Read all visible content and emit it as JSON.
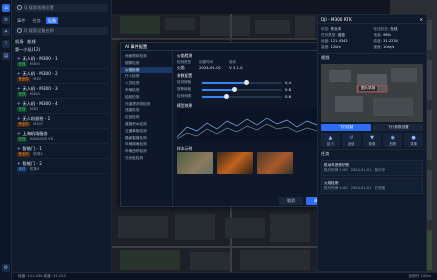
{
  "search": {
    "placeholder": "Q 搜索地理位置"
  },
  "left": {
    "tabs": [
      "事件",
      "任务",
      "设备"
    ],
    "filter_placeholder": "Q 搜索设备名称",
    "group_labels": [
      "机场",
      "航线"
    ],
    "group_count": "第一小队(12)",
    "devices": [
      {
        "name": "无人机 - M300 - 1",
        "id": "M300",
        "status": "在线",
        "sub": "M300"
      },
      {
        "name": "无人机 - M300 - 2",
        "id": "M30",
        "status": "作业中",
        "sub": "M30"
      },
      {
        "name": "无人机 - M300 - 3",
        "id": "M300",
        "status": "在线",
        "sub": "M300"
      },
      {
        "name": "无人机 - M300 - 4",
        "id": "M3D",
        "status": "在线",
        "sub": "M3D"
      },
      {
        "name": "无人机巡检 - 1",
        "id": "M30T",
        "status": "作业中",
        "sub": "M30T"
      },
      {
        "name": "上海机场服务",
        "id": "HAVASOR V6",
        "status": "在线",
        "sub": "V6"
      },
      {
        "name": "智能门 - 1",
        "id": "机场2",
        "status": "作业中",
        "sub": "机场"
      },
      {
        "name": "智能门 - 2",
        "id": "机场3",
        "status": "离线",
        "sub": "机场"
      }
    ]
  },
  "modal": {
    "title": "AI 事件配置",
    "nav": [
      "地面物体检测",
      "烟雾检测",
      "火焰检测",
      "行人检测",
      "人员检测",
      "车辆检测",
      "船舶检测",
      "河道漂浮物检测",
      "违建检测",
      "垃圾检测",
      "道路积水检测",
      "交通事故检测",
      "路面裂缝检测",
      "车辆拥堵检测",
      "车辆违停检测",
      "光伏板检测"
    ],
    "section": "火焰检测",
    "fields": [
      {
        "label": "检测类型",
        "value": "火焰"
      },
      {
        "label": "版本",
        "value": "V 3.1.0"
      },
      {
        "label": "创建时间",
        "value": "2024-01-01"
      }
    ],
    "param_title": "参数配置",
    "sliders": [
      {
        "label": "检测阈值",
        "value": "0.4",
        "level": 0.55
      },
      {
        "label": "报警阈值",
        "value": "0.8",
        "level": 0.4
      },
      {
        "label": "检测间隔",
        "value": "0.6",
        "level": 0.3
      }
    ],
    "chart_title": "模型效果",
    "sample_title": "样本示例",
    "cancel": "取消",
    "confirm": "确定"
  },
  "right": {
    "title": "DJI - M300 RTK",
    "close": "✕",
    "kv": [
      {
        "k": "状态:",
        "v": "作业中"
      },
      {
        "k": "在线状态:",
        "v": "在线"
      },
      {
        "k": "任务类型:",
        "v": "巡检"
      },
      {
        "k": "电量:",
        "v": "96%"
      },
      {
        "k": "经度:",
        "v": "121.4342"
      },
      {
        "k": "纬度:",
        "v": "31.2234"
      },
      {
        "k": "高度:",
        "v": "120m"
      },
      {
        "k": "速度:",
        "v": "10m/s"
      }
    ],
    "video_title": "视频",
    "video_label": "图片机场",
    "btn_left": "飞行控制",
    "btn_right": "飞行参数设置",
    "controls": [
      "起飞",
      "返航",
      "降落",
      "拍照",
      "录像"
    ],
    "tasks_title": "任务",
    "tasks": [
      {
        "title": "机动车违停识别",
        "a": "执行时间 1:00",
        "b": "2024-01-01",
        "c": "执行中"
      },
      {
        "title": "火焰检测",
        "a": "执行时间 1:00",
        "b": "2024-01-01",
        "c": "已完成"
      }
    ]
  },
  "bottom": {
    "left": "经度: 121.434 纬度: 31.223",
    "right": "比例尺 100m"
  },
  "colors": {
    "accent": "#2c6df2",
    "green": "#45d483",
    "orange": "#ff9b3f"
  }
}
